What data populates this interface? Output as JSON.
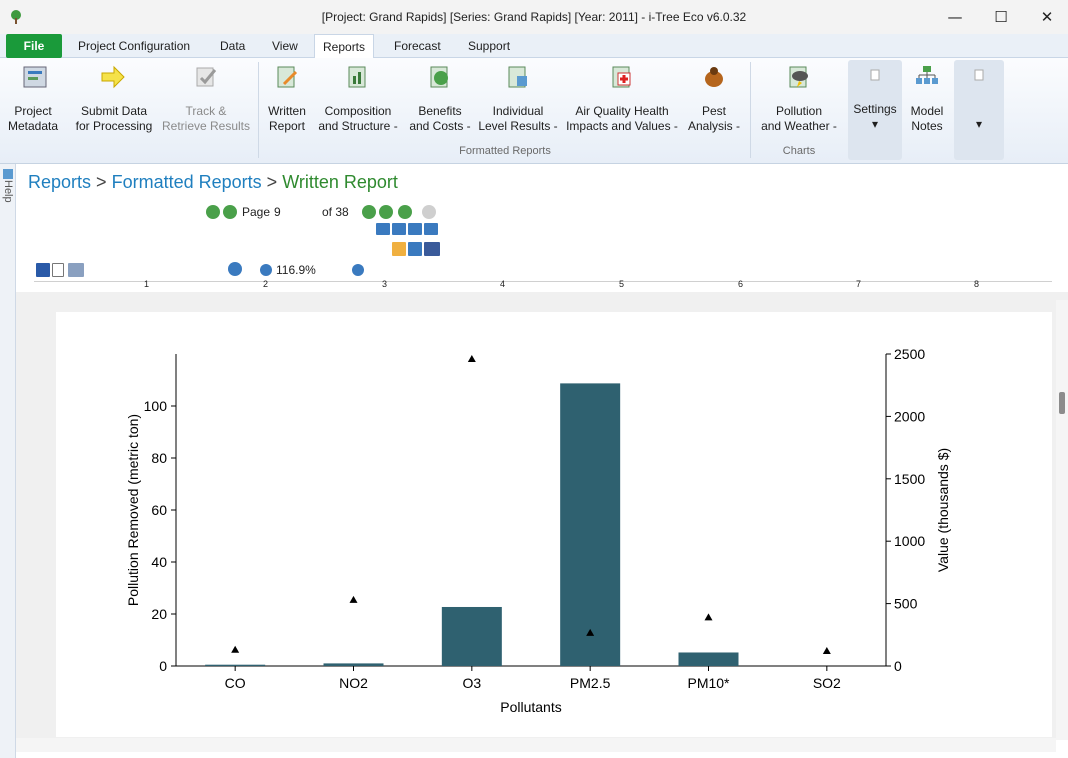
{
  "window": {
    "title": "[Project: Grand Rapids] [Series: Grand Rapids] [Year: 2011] - i-Tree Eco v6.0.32",
    "minimize": "—",
    "maximize": "☐",
    "close": "✕"
  },
  "menu": {
    "file": "File",
    "items": [
      "Project Configuration",
      "Data",
      "View",
      "Reports",
      "Forecast",
      "Support"
    ],
    "active": "Reports"
  },
  "ribbon": {
    "buttons": [
      {
        "label1": "Project",
        "label2": "Metadata",
        "icon": "project-metadata-icon",
        "enabled": true
      },
      {
        "label1": "Submit Data",
        "label2": "for Processing",
        "icon": "arrow-right-icon",
        "enabled": true
      },
      {
        "label1": "Track &",
        "label2": "Retrieve Results",
        "icon": "track-icon",
        "enabled": false
      },
      {
        "label1": "Written",
        "label2": "Report",
        "icon": "written-report-icon",
        "enabled": true
      },
      {
        "label1": "Composition",
        "label2": "and Structure -",
        "icon": "composition-icon",
        "enabled": true
      },
      {
        "label1": "Benefits",
        "label2": "and Costs -",
        "icon": "benefits-icon",
        "enabled": true
      },
      {
        "label1": "Individual",
        "label2": "Level Results -",
        "icon": "individual-icon",
        "enabled": true
      },
      {
        "label1": "Air Quality Health",
        "label2": "Impacts and Values -",
        "icon": "health-icon",
        "enabled": true
      },
      {
        "label1": "Pest",
        "label2": "Analysis -",
        "icon": "pest-icon",
        "enabled": true
      },
      {
        "label1": "Pollution",
        "label2": "and Weather -",
        "icon": "weather-icon",
        "enabled": true
      },
      {
        "label1": "Settings",
        "label2": "▾",
        "icon": "settings-icon",
        "enabled": true
      },
      {
        "label1": "Model",
        "label2": "Notes",
        "icon": "model-notes-icon",
        "enabled": true
      },
      {
        "label1": "",
        "label2": "▾",
        "icon": "dropdown-icon",
        "enabled": true
      }
    ],
    "group_formatted": "Formatted Reports",
    "group_charts": "Charts"
  },
  "help_tab": "Help",
  "breadcrumb": {
    "part1": "Reports",
    "sep": ">",
    "part2": "Formatted Reports",
    "part3": "Written Report"
  },
  "viewer": {
    "page_label": "Page",
    "page_value": "9",
    "of_label": "of 38",
    "zoom_value": "116.9%"
  },
  "ruler_numbers": [
    "1",
    "2",
    "3",
    "4",
    "5",
    "6",
    "7",
    "8"
  ],
  "chart_data": {
    "type": "bar",
    "categories": [
      "CO",
      "NO2",
      "O3",
      "PM2.5",
      "PM10*",
      "SO2"
    ],
    "series": [
      {
        "name": "Pollution Removed (metric ton)",
        "axis": "left",
        "kind": "bar",
        "values": [
          0.5,
          1.0,
          22.7,
          108.7,
          5.2,
          0.0
        ]
      },
      {
        "name": "Value (thousands $)",
        "axis": "right",
        "kind": "marker",
        "values": [
          130,
          530,
          2460,
          265,
          390,
          120
        ]
      }
    ],
    "xlabel": "Pollutants",
    "ylabel": "Pollution Removed (metric ton)",
    "y2label": "Value (thousands $)",
    "ylim": [
      0,
      120
    ],
    "y2lim": [
      0,
      2500
    ],
    "yticks": [
      0,
      20,
      40,
      60,
      80,
      100
    ],
    "y2ticks": [
      0,
      500,
      1000,
      1500,
      2000,
      2500
    ],
    "colors": {
      "bar": "#2f6170",
      "marker": "#000000"
    },
    "grid": false
  }
}
